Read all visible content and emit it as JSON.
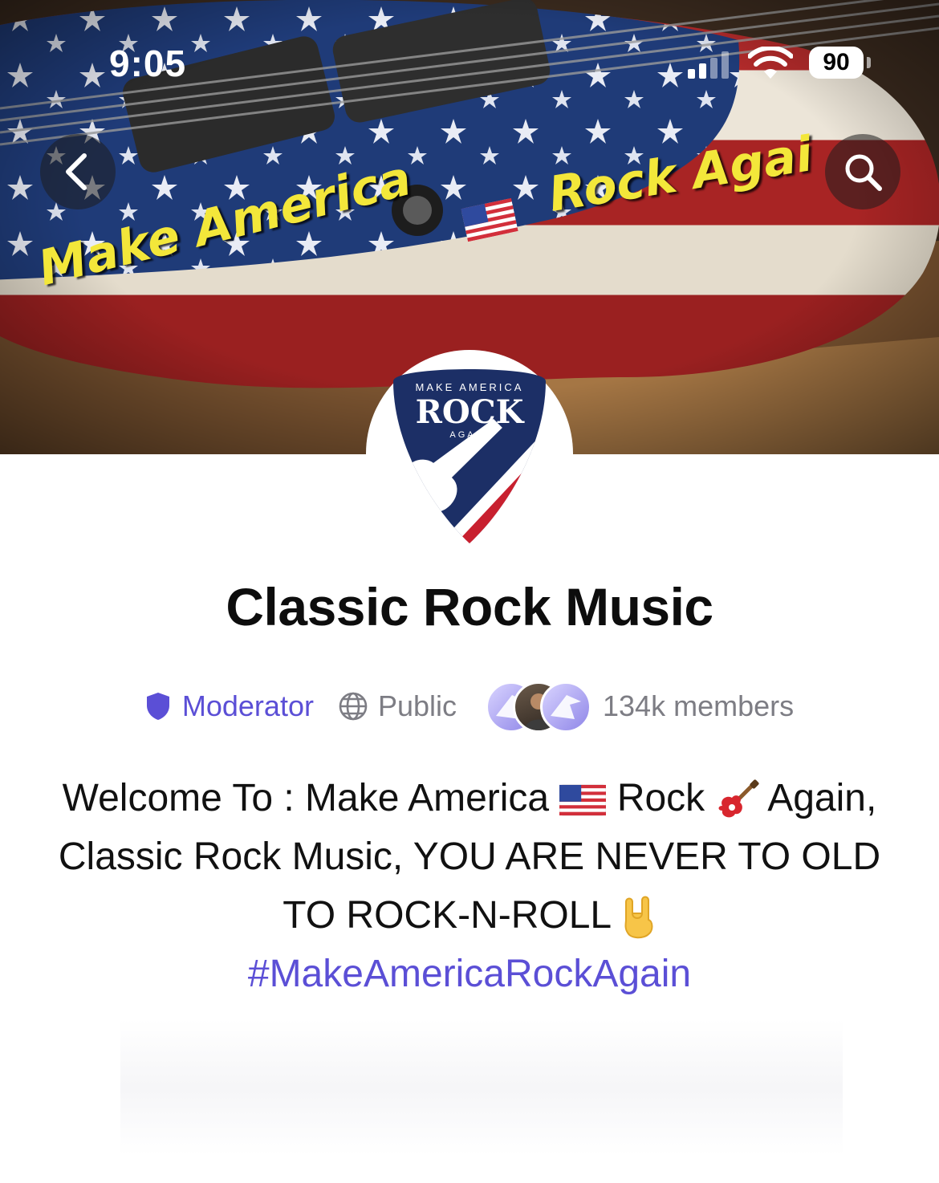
{
  "status_bar": {
    "time": "9:05",
    "battery": "90"
  },
  "banner": {
    "text_left": "Make America",
    "text_right": "Rock Agai"
  },
  "logo": {
    "top_text": "MAKE AMERICA",
    "main_text": "ROCK",
    "bottom_text": "AGAIN"
  },
  "group": {
    "title": "Classic Rock Music",
    "role": "Moderator",
    "visibility": "Public",
    "members": "134k members"
  },
  "description": {
    "part1": "Welcome To : Make America",
    "part2": "Rock",
    "part3": "Again, Classic Rock Music, YOU ARE NEVER TO OLD TO ROCK-N-ROLL",
    "hashtag": "#MakeAmericaRockAgain"
  },
  "colors": {
    "accent": "#5b4fd6",
    "muted": "#7d7d84",
    "banner_text": "#f3e73a"
  },
  "icons": {
    "back": "chevron-left-icon",
    "search": "search-icon",
    "shield": "shield-icon",
    "globe": "globe-icon",
    "flag": "us-flag-emoji",
    "guitar": "guitar-emoji",
    "rock_hand": "rock-hand-emoji"
  }
}
